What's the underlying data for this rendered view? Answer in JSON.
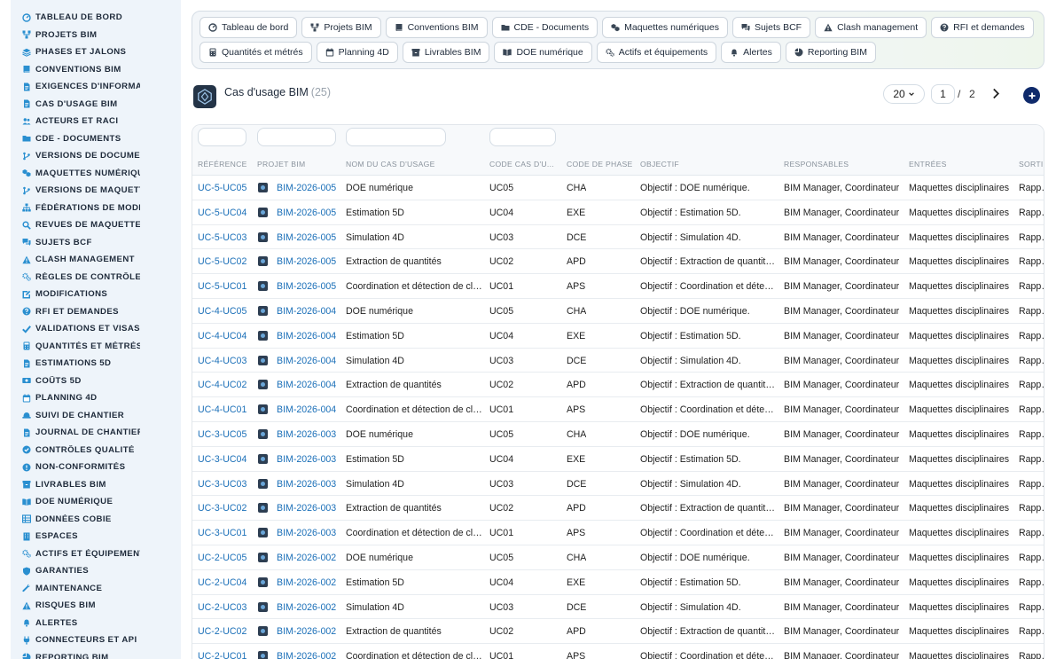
{
  "sidebar": {
    "items": [
      {
        "label": "TABLEAU DE BORD",
        "icon": "dashboard-icon"
      },
      {
        "label": "PROJETS BIM",
        "icon": "network-icon"
      },
      {
        "label": "PHASES ET JALONS",
        "icon": "layers-icon"
      },
      {
        "label": "CONVENTIONS BIM",
        "icon": "book-icon"
      },
      {
        "label": "EXIGENCES D'INFORMATI",
        "icon": "document-icon"
      },
      {
        "label": "CAS D'USAGE BIM",
        "icon": "document-icon"
      },
      {
        "label": "ACTEURS ET RACI",
        "icon": "users-icon"
      },
      {
        "label": "CDE - DOCUMENTS",
        "icon": "folder-icon"
      },
      {
        "label": "VERSIONS DE DOCUMEN",
        "icon": "branch-icon"
      },
      {
        "label": "MAQUETTES NUMÉRIQU",
        "icon": "cubes-icon"
      },
      {
        "label": "VERSIONS DE MAQUETT",
        "icon": "branch-icon"
      },
      {
        "label": "FÉDÉRATIONS DE MODÈ",
        "icon": "hierarchy-icon"
      },
      {
        "label": "REVUES DE MAQUETTES",
        "icon": "search-icon"
      },
      {
        "label": "SUJETS BCF",
        "icon": "comments-icon"
      },
      {
        "label": "CLASH MANAGEMENT",
        "icon": "warning-icon"
      },
      {
        "label": "RÈGLES DE CONTRÔLE",
        "icon": "gears-icon"
      },
      {
        "label": "MODIFICATIONS",
        "icon": "edit-icon"
      },
      {
        "label": "RFI ET DEMANDES",
        "icon": "question-icon"
      },
      {
        "label": "VALIDATIONS ET VISAS",
        "icon": "check-icon"
      },
      {
        "label": "QUANTITÉS ET MÉTRÉS",
        "icon": "calculator-icon"
      },
      {
        "label": "ESTIMATIONS 5D",
        "icon": "document-icon"
      },
      {
        "label": "COÛTS 5D",
        "icon": "money-icon"
      },
      {
        "label": "PLANNING 4D",
        "icon": "calendar-icon"
      },
      {
        "label": "SUIVI DE CHANTIER",
        "icon": "helmet-icon"
      },
      {
        "label": "JOURNAL DE CHANTIER",
        "icon": "document-icon"
      },
      {
        "label": "CONTRÔLES QUALITÉ",
        "icon": "check-circle-icon"
      },
      {
        "label": "NON-CONFORMITÉS",
        "icon": "alert-circle-icon"
      },
      {
        "label": "LIVRABLES BIM",
        "icon": "box-icon"
      },
      {
        "label": "DOE NUMÉRIQUE",
        "icon": "book-open-icon"
      },
      {
        "label": "DONNÉES COBIE",
        "icon": "table-icon"
      },
      {
        "label": "ESPACES",
        "icon": "building-icon"
      },
      {
        "label": "ACTIFS ET ÉQUIPEMENTS",
        "icon": "gears-icon"
      },
      {
        "label": "GARANTIES",
        "icon": "shield-icon"
      },
      {
        "label": "MAINTENANCE",
        "icon": "wrench-icon"
      },
      {
        "label": "RISQUES BIM",
        "icon": "warning-icon"
      },
      {
        "label": "ALERTES",
        "icon": "bell-icon"
      },
      {
        "label": "CONNECTEURS ET API",
        "icon": "plug-icon"
      },
      {
        "label": "REPORTING BIM",
        "icon": "chart-icon"
      }
    ]
  },
  "toolbar": {
    "buttons": [
      {
        "label": "Tableau de bord",
        "icon": "dashboard-icon"
      },
      {
        "label": "Projets BIM",
        "icon": "network-icon"
      },
      {
        "label": "Conventions BIM",
        "icon": "book-icon"
      },
      {
        "label": "CDE - Documents",
        "icon": "folder-icon"
      },
      {
        "label": "Maquettes numériques",
        "icon": "cubes-icon"
      },
      {
        "label": "Sujets BCF",
        "icon": "comments-icon"
      },
      {
        "label": "Clash management",
        "icon": "warning-icon"
      },
      {
        "label": "RFI et demandes",
        "icon": "question-icon"
      },
      {
        "label": "Quantités et métrés",
        "icon": "calculator-icon"
      },
      {
        "label": "Planning 4D",
        "icon": "calendar-icon"
      },
      {
        "label": "Livrables BIM",
        "icon": "box-icon"
      },
      {
        "label": "DOE numérique",
        "icon": "book-open-icon"
      },
      {
        "label": "Actifs et équipements",
        "icon": "gears-icon"
      },
      {
        "label": "Alertes",
        "icon": "bell-icon"
      },
      {
        "label": "Reporting BIM",
        "icon": "chart-icon"
      }
    ]
  },
  "header": {
    "title": "Cas d'usage BIM",
    "count": "(25)"
  },
  "pagination": {
    "per_page": "20",
    "current_page": "1",
    "separator": "/",
    "total_pages": "2"
  },
  "table": {
    "columns": [
      "RÉFÉRENCE",
      "PROJET BIM",
      "NOM DU CAS D'USAGE",
      "CODE CAS D'U...",
      "CODE DE PHASE",
      "OBJECTIF",
      "RESPONSABLES",
      "ENTRÉES",
      "SORTIES"
    ],
    "rows": [
      [
        "UC-5-UC05",
        "BIM-2026-005",
        "DOE numérique",
        "UC05",
        "CHA",
        "Objectif : DOE numérique.",
        "BIM Manager, Coordinateur",
        "Maquettes disciplinaires",
        "Rapports"
      ],
      [
        "UC-5-UC04",
        "BIM-2026-005",
        "Estimation 5D",
        "UC04",
        "EXE",
        "Objectif : Estimation 5D.",
        "BIM Manager, Coordinateur",
        "Maquettes disciplinaires",
        "Rapports"
      ],
      [
        "UC-5-UC03",
        "BIM-2026-005",
        "Simulation 4D",
        "UC03",
        "DCE",
        "Objectif : Simulation 4D.",
        "BIM Manager, Coordinateur",
        "Maquettes disciplinaires",
        "Rapports"
      ],
      [
        "UC-5-UC02",
        "BIM-2026-005",
        "Extraction de quantités",
        "UC02",
        "APD",
        "Objectif : Extraction de quantités.",
        "BIM Manager, Coordinateur",
        "Maquettes disciplinaires",
        "Rapports"
      ],
      [
        "UC-5-UC01",
        "BIM-2026-005",
        "Coordination et détection de clashs",
        "UC01",
        "APS",
        "Objectif : Coordination et détection de clashs.",
        "BIM Manager, Coordinateur",
        "Maquettes disciplinaires",
        "Rapports"
      ],
      [
        "UC-4-UC05",
        "BIM-2026-004",
        "DOE numérique",
        "UC05",
        "CHA",
        "Objectif : DOE numérique.",
        "BIM Manager, Coordinateur",
        "Maquettes disciplinaires",
        "Rapports"
      ],
      [
        "UC-4-UC04",
        "BIM-2026-004",
        "Estimation 5D",
        "UC04",
        "EXE",
        "Objectif : Estimation 5D.",
        "BIM Manager, Coordinateur",
        "Maquettes disciplinaires",
        "Rapports"
      ],
      [
        "UC-4-UC03",
        "BIM-2026-004",
        "Simulation 4D",
        "UC03",
        "DCE",
        "Objectif : Simulation 4D.",
        "BIM Manager, Coordinateur",
        "Maquettes disciplinaires",
        "Rapports"
      ],
      [
        "UC-4-UC02",
        "BIM-2026-004",
        "Extraction de quantités",
        "UC02",
        "APD",
        "Objectif : Extraction de quantités.",
        "BIM Manager, Coordinateur",
        "Maquettes disciplinaires",
        "Rapports"
      ],
      [
        "UC-4-UC01",
        "BIM-2026-004",
        "Coordination et détection de clashs",
        "UC01",
        "APS",
        "Objectif : Coordination et détection de clashs.",
        "BIM Manager, Coordinateur",
        "Maquettes disciplinaires",
        "Rapports"
      ],
      [
        "UC-3-UC05",
        "BIM-2026-003",
        "DOE numérique",
        "UC05",
        "CHA",
        "Objectif : DOE numérique.",
        "BIM Manager, Coordinateur",
        "Maquettes disciplinaires",
        "Rapports"
      ],
      [
        "UC-3-UC04",
        "BIM-2026-003",
        "Estimation 5D",
        "UC04",
        "EXE",
        "Objectif : Estimation 5D.",
        "BIM Manager, Coordinateur",
        "Maquettes disciplinaires",
        "Rapports"
      ],
      [
        "UC-3-UC03",
        "BIM-2026-003",
        "Simulation 4D",
        "UC03",
        "DCE",
        "Objectif : Simulation 4D.",
        "BIM Manager, Coordinateur",
        "Maquettes disciplinaires",
        "Rapports"
      ],
      [
        "UC-3-UC02",
        "BIM-2026-003",
        "Extraction de quantités",
        "UC02",
        "APD",
        "Objectif : Extraction de quantités.",
        "BIM Manager, Coordinateur",
        "Maquettes disciplinaires",
        "Rapports"
      ],
      [
        "UC-3-UC01",
        "BIM-2026-003",
        "Coordination et détection de clashs",
        "UC01",
        "APS",
        "Objectif : Coordination et détection de clashs.",
        "BIM Manager, Coordinateur",
        "Maquettes disciplinaires",
        "Rapports"
      ],
      [
        "UC-2-UC05",
        "BIM-2026-002",
        "DOE numérique",
        "UC05",
        "CHA",
        "Objectif : DOE numérique.",
        "BIM Manager, Coordinateur",
        "Maquettes disciplinaires",
        "Rapports"
      ],
      [
        "UC-2-UC04",
        "BIM-2026-002",
        "Estimation 5D",
        "UC04",
        "EXE",
        "Objectif : Estimation 5D.",
        "BIM Manager, Coordinateur",
        "Maquettes disciplinaires",
        "Rapports"
      ],
      [
        "UC-2-UC03",
        "BIM-2026-002",
        "Simulation 4D",
        "UC03",
        "DCE",
        "Objectif : Simulation 4D.",
        "BIM Manager, Coordinateur",
        "Maquettes disciplinaires",
        "Rapports"
      ],
      [
        "UC-2-UC02",
        "BIM-2026-002",
        "Extraction de quantités",
        "UC02",
        "APD",
        "Objectif : Extraction de quantités.",
        "BIM Manager, Coordinateur",
        "Maquettes disciplinaires",
        "Rapports"
      ],
      [
        "UC-2-UC01",
        "BIM-2026-002",
        "Coordination et détection de clashs",
        "UC01",
        "APS",
        "Objectif : Coordination et détection de clashs.",
        "BIM Manager, Coordinateur",
        "Maquettes disciplinaires",
        "Rapports"
      ]
    ]
  },
  "colors": {
    "sidebar_bg": "#eef4fa",
    "link": "#1a6fb8",
    "accent": "#0f2a6b",
    "text": "#1e2a3a",
    "icon": "#2a8fd0"
  }
}
